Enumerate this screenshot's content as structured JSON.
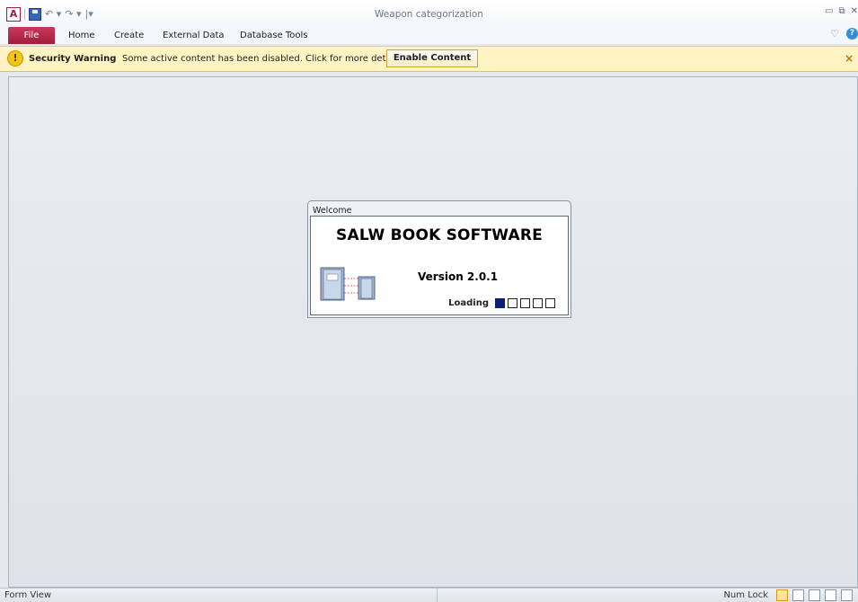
{
  "app": {
    "window_title": "Weapon categorization"
  },
  "qat": {
    "app_letter": "A",
    "undo": "↶ ▾",
    "redo": "↷ ▾",
    "customize": "|▾"
  },
  "window_controls": {
    "minimize": "▭",
    "restore": "⧉",
    "close": "✕"
  },
  "ribbon": {
    "tabs": [
      "File",
      "Home",
      "Create",
      "External Data",
      "Database Tools"
    ],
    "help": "?"
  },
  "security": {
    "title": "Security Warning",
    "message": "Some active content has been disabled. Click for more details.",
    "button": "Enable Content",
    "close": "×"
  },
  "dialog": {
    "title": "Welcome",
    "heading": "SALW BOOK SOFTWARE",
    "version": "Version  2.0.1",
    "loading_label": "Loading",
    "loading_progress": {
      "filled": 1,
      "total": 5
    }
  },
  "status": {
    "left": "Form View",
    "numlock": "Num Lock"
  },
  "colors": {
    "file_tab": "#a31d3a",
    "security_bar": "#fff4c2",
    "loading_fill": "#0b1f7a"
  }
}
